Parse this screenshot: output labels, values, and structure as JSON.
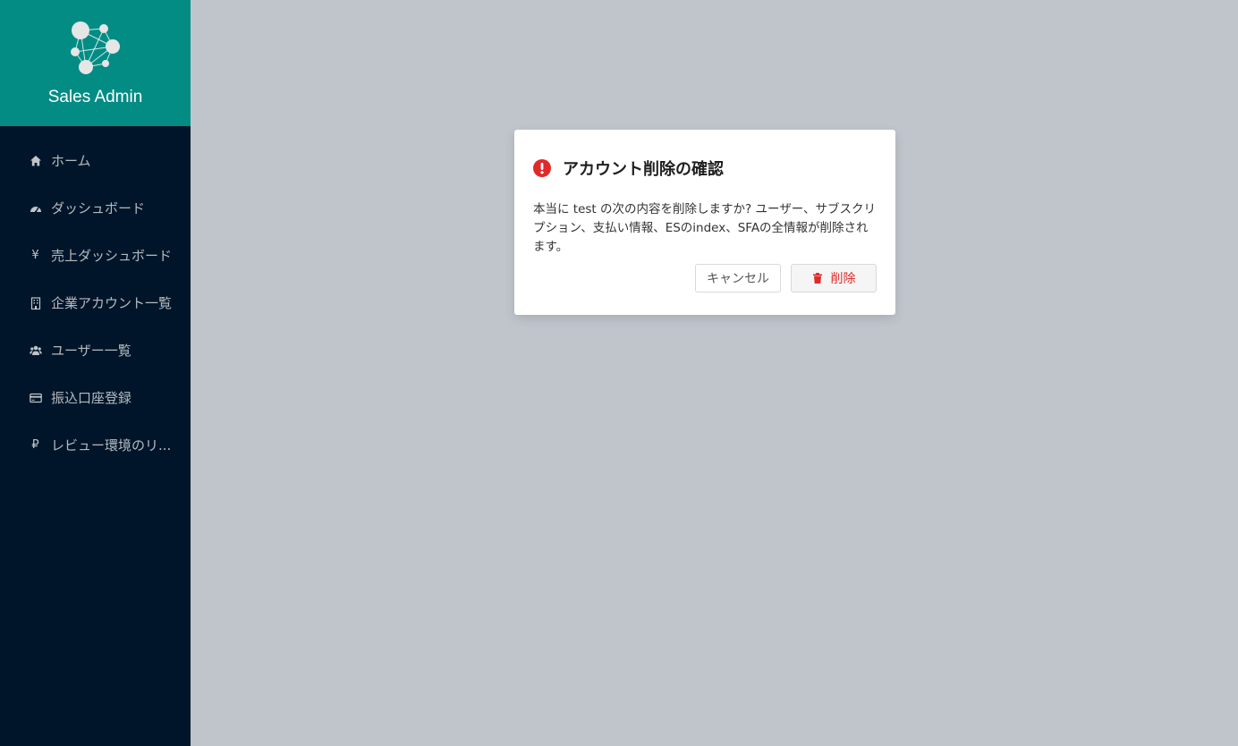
{
  "brand": {
    "name": "Sales Admin",
    "logo_icon": "network-nodes-icon"
  },
  "sidebar": {
    "items": [
      {
        "label": "ホーム",
        "icon": "home-icon"
      },
      {
        "label": "ダッシュボード",
        "icon": "dashboard-icon"
      },
      {
        "label": "売上ダッシュボード",
        "icon": "yen-icon"
      },
      {
        "label": "企業アカウント一覧",
        "icon": "building-icon"
      },
      {
        "label": "ユーザー一覧",
        "icon": "users-icon"
      },
      {
        "label": "振込口座登録",
        "icon": "credit-card-icon"
      },
      {
        "label": "レビュー環境のリ...",
        "icon": "ruble-icon"
      }
    ]
  },
  "modal": {
    "title": "アカウント削除の確認",
    "message": "本当に test の次の内容を削除しますか? ユーザー、サブスクリプション、支払い情報、ESのindex、SFAの全情報が削除されます。",
    "cancel_label": "キャンセル",
    "delete_label": "削除",
    "icon": "exclamation-circle-icon"
  },
  "colors": {
    "brand_bg": "#028c84",
    "sidebar_bg": "#001529",
    "overlay_bg": "#c0c5cc",
    "danger": "#e02a2a"
  }
}
